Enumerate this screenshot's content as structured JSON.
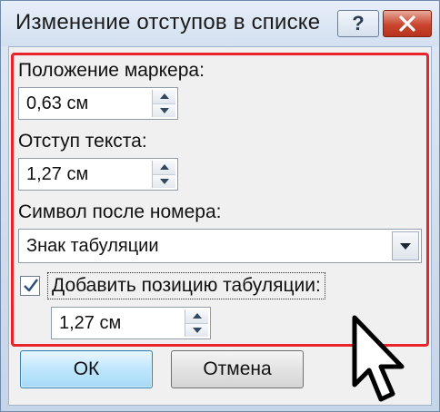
{
  "window": {
    "title": "Изменение отступов в списке",
    "help_label": "?"
  },
  "form": {
    "marker_position_label": "Положение маркера:",
    "marker_position_value": "0,63 см",
    "text_indent_label": "Отступ текста:",
    "text_indent_value": "1,27 см",
    "symbol_after_number_label": "Символ после номера:",
    "symbol_after_number_value": "Знак табуляции",
    "add_tab_stop_label": "Добавить позицию табуляции:",
    "add_tab_stop_checked": true,
    "tab_stop_value": "1,27 см"
  },
  "buttons": {
    "ok_label": "ОК",
    "cancel_label": "Отмена"
  },
  "colors": {
    "highlight": "#e8232a",
    "close_button": "#c9452e"
  }
}
